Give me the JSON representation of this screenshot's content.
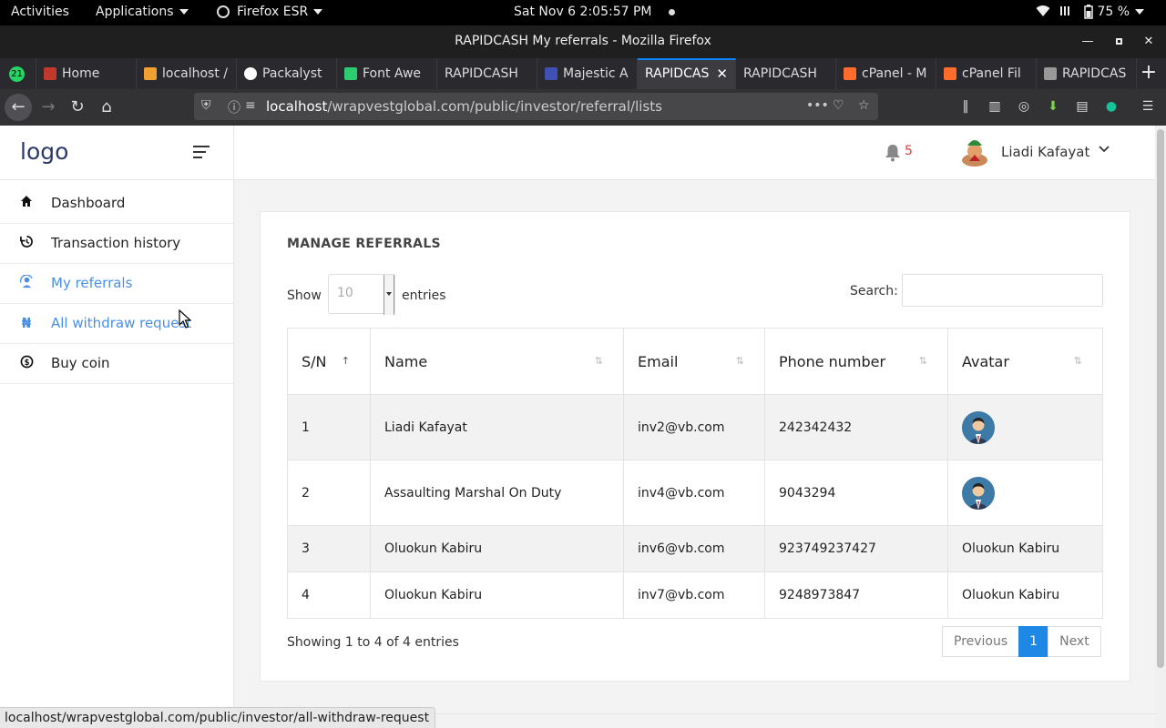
{
  "system_bar": {
    "activities": "Activities",
    "applications": "Applications",
    "firefox": "Firefox ESR",
    "clock": "Sat Nov 6   2:05:57 PM",
    "battery": "75 %"
  },
  "window": {
    "title": "RAPIDCASH My referrals - Mozilla Firefox"
  },
  "tabs": [
    {
      "label": "21",
      "favicon": "whatsapp-icon",
      "color": "#25d366"
    },
    {
      "label": "Home",
      "favicon": "profile-icon",
      "color": "#c0392b"
    },
    {
      "label": "localhost /",
      "favicon": "phpmyadmin-icon",
      "color": "#f0a030"
    },
    {
      "label": "Packalyst",
      "favicon": "google-icon",
      "color": "#ffffff"
    },
    {
      "label": "Font Awe",
      "favicon": "wix-icon",
      "color": "#2ecc71"
    },
    {
      "label": "RAPIDCASH",
      "favicon": "",
      "color": ""
    },
    {
      "label": "Majestic A",
      "favicon": "bootstrap-icon",
      "color": "#3f51b5"
    },
    {
      "label": "RAPIDCAS",
      "favicon": "",
      "color": "",
      "active": true
    },
    {
      "label": "RAPIDCASH",
      "favicon": "",
      "color": ""
    },
    {
      "label": "cPanel - M",
      "favicon": "cpanel-icon",
      "color": "#ff6c2c"
    },
    {
      "label": "cPanel Fil",
      "favicon": "cpanel-icon",
      "color": "#ff6c2c"
    },
    {
      "label": "RAPIDCAS",
      "favicon": "rapidcash-icon",
      "color": "#999999"
    }
  ],
  "navbar": {
    "url_host": "localhost",
    "url_path": "/wrapvestglobal.com/public/investor/referral/lists"
  },
  "sidebar": {
    "logo": "logo",
    "items": [
      {
        "label": "Dashboard",
        "icon": "home-icon"
      },
      {
        "label": "Transaction history",
        "icon": "history-icon"
      },
      {
        "label": "My referrals",
        "icon": "referral-icon"
      },
      {
        "label": "All withdraw request",
        "icon": "naira-icon"
      },
      {
        "label": "Buy coin",
        "icon": "coin-icon"
      }
    ]
  },
  "header": {
    "notification_count": "5",
    "user_name": "Liadi Kafayat"
  },
  "card": {
    "title": "MANAGE REFERRALS",
    "show_label": "Show",
    "entries_value": "10",
    "entries_label": "entries",
    "search_label": "Search:",
    "search_value": ""
  },
  "table": {
    "columns": [
      "S/N",
      "Name",
      "Email",
      "Phone number",
      "Avatar"
    ],
    "rows": [
      {
        "sn": "1",
        "name": "Liadi Kafayat",
        "email": "inv2@vb.com",
        "phone": "242342432",
        "avatar": "",
        "has_image": true
      },
      {
        "sn": "2",
        "name": "Assaulting Marshal On Duty",
        "email": "inv4@vb.com",
        "phone": "9043294",
        "avatar": "",
        "has_image": true
      },
      {
        "sn": "3",
        "name": "Oluokun Kabiru",
        "email": "inv6@vb.com",
        "phone": "923749237427",
        "avatar": "Oluokun Kabiru",
        "has_image": false
      },
      {
        "sn": "4",
        "name": "Oluokun Kabiru",
        "email": "inv7@vb.com",
        "phone": "9248973847",
        "avatar": "Oluokun Kabiru",
        "has_image": false
      }
    ]
  },
  "footer": {
    "info": "Showing 1 to 4 of 4 entries",
    "prev": "Previous",
    "page": "1",
    "next": "Next"
  },
  "status_url": "localhost/wrapvestglobal.com/public/investor/all-withdraw-request",
  "colors": {
    "accent": "#1e88e5",
    "link_highlight": "#4a8fe7",
    "notification": "#e53935"
  }
}
